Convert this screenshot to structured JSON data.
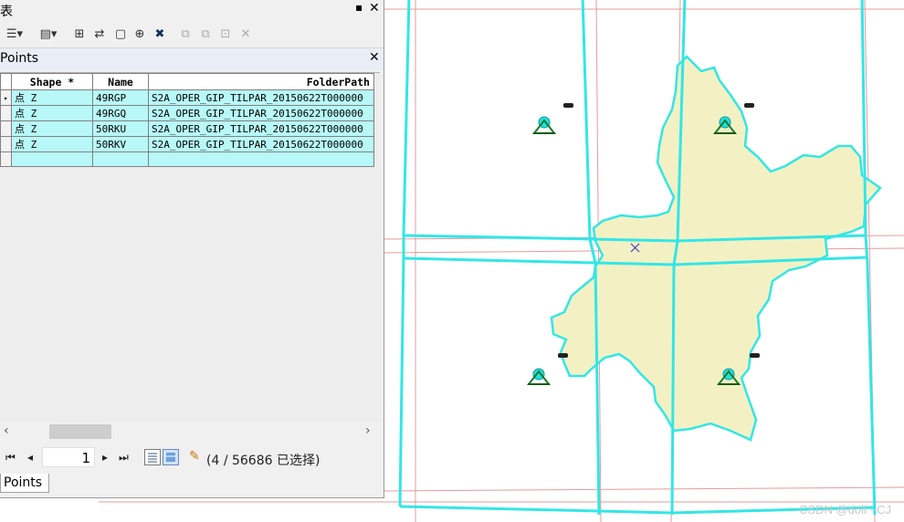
{
  "window": {
    "title": "表",
    "pin_glyph": "▪",
    "close_glyph": "✕"
  },
  "toolbar": {
    "icons": [
      "table-options-icon",
      "related-tables-icon",
      "select-by-attributes-icon",
      "switch-selection-icon",
      "clear-selection-icon",
      "zoom-to-selected-icon",
      "delete-selected-icon",
      "copy-icon",
      "paste-icon",
      "cut-icon",
      "delete-icon"
    ]
  },
  "tab": {
    "name": "Points",
    "close_glyph": "✕"
  },
  "table": {
    "columns": [
      "Shape *",
      "Name",
      "FolderPath"
    ],
    "rows": [
      {
        "shape": "点 Z",
        "name": "49RGP",
        "folder": "S2A_OPER_GIP_TILPAR_20150622T000000"
      },
      {
        "shape": "点 Z",
        "name": "49RGQ",
        "folder": "S2A_OPER_GIP_TILPAR_20150622T000000"
      },
      {
        "shape": "点 Z",
        "name": "50RKU",
        "folder": "S2A_OPER_GIP_TILPAR_20150622T000000"
      },
      {
        "shape": "点 Z",
        "name": "50RKV",
        "folder": "S2A_OPER_GIP_TILPAR_20150622T000000"
      }
    ],
    "current_row_marker": "▸"
  },
  "scroll": {
    "left_glyph": "‹",
    "right_glyph": "›"
  },
  "navigator": {
    "first_glyph": "⏮",
    "prev_glyph": "◂",
    "page": "1",
    "next_glyph": "▸",
    "last_glyph": "⏭",
    "selection_text": "(4 / 56686 已选择)"
  },
  "bottom_tab": {
    "label": "Points"
  },
  "map": {
    "watermark": "CSDN @doll ~CJ",
    "colors": {
      "tile_outline": "#33e6e6",
      "grid_line": "#e89a9a",
      "polygon_fill": "#f3f1c4",
      "point_marker": "#1fe0e0"
    }
  }
}
